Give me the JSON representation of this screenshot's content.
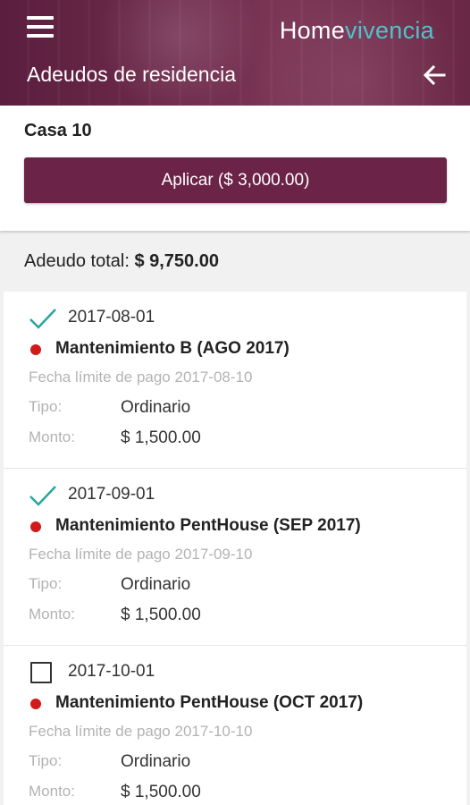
{
  "header": {
    "brand_part1": "Home",
    "brand_part2": "vivencia",
    "title": "Adeudos de residencia",
    "menu_icon": "hamburger-menu-icon",
    "back_icon": "arrow-left-icon",
    "colors": {
      "bar": "#6b2347",
      "brand_accent": "#4fc3c8"
    }
  },
  "residence": {
    "name": "Casa 10",
    "apply_label": "Aplicar ($ 3,000.00)"
  },
  "summary": {
    "label": "Adeudo total:",
    "amount": "$ 9,750.00"
  },
  "labels": {
    "tipo": "Tipo:",
    "monto": "Monto:"
  },
  "items": [
    {
      "checked": true,
      "date": "2017-08-01",
      "name": "Mantenimiento B (AGO 2017)",
      "deadline": "Fecha límite de pago 2017-08-10",
      "tipo": "Ordinario",
      "monto": "$ 1,500.00"
    },
    {
      "checked": true,
      "date": "2017-09-01",
      "name": "Mantenimiento PentHouse (SEP 2017)",
      "deadline": "Fecha límite de pago 2017-09-10",
      "tipo": "Ordinario",
      "monto": "$ 1,500.00"
    },
    {
      "checked": false,
      "date": "2017-10-01",
      "name": "Mantenimiento PentHouse (OCT 2017)",
      "deadline": "Fecha límite de pago 2017-10-10",
      "tipo": "Ordinario",
      "monto": "$ 1,500.00"
    }
  ]
}
